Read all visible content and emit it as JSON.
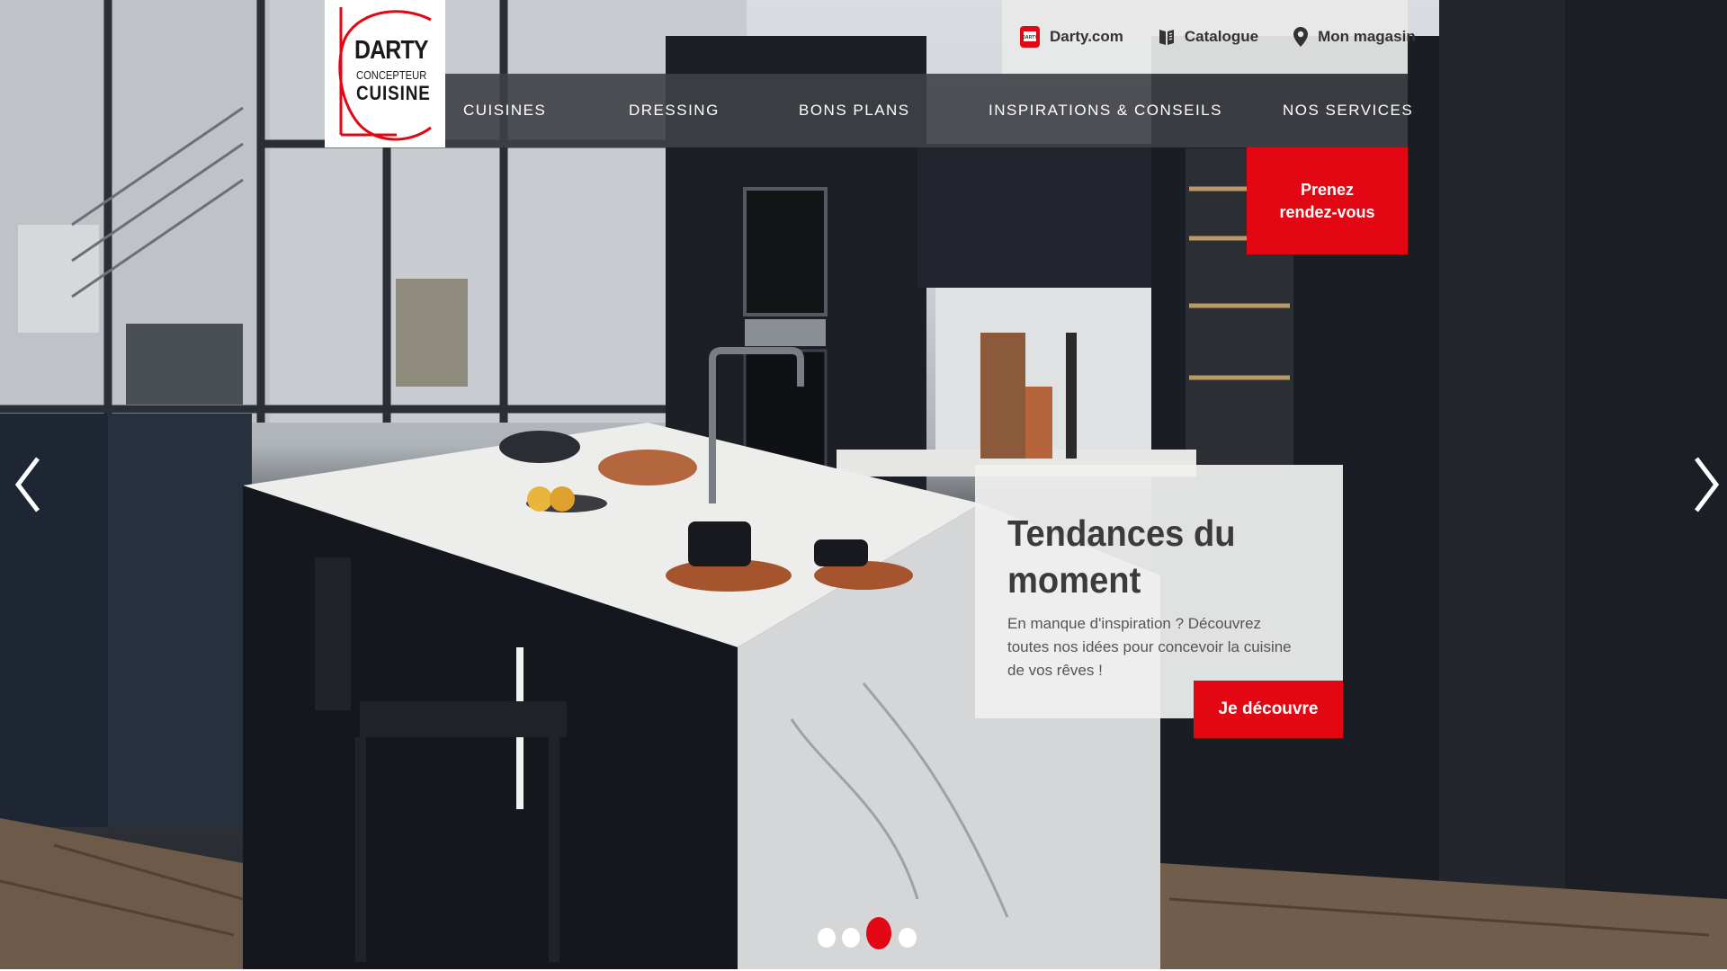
{
  "brand": {
    "logo_line1": "DARTY",
    "logo_line2": "CONCEPTEUR",
    "logo_line3": "CUISINE",
    "accent_color": "#e30613"
  },
  "utility_nav": [
    {
      "label": "Darty.com",
      "icon": "darty-logo-icon"
    },
    {
      "label": "Catalogue",
      "icon": "book-icon"
    },
    {
      "label": "Mon magasin",
      "icon": "location-pin-icon"
    }
  ],
  "main_nav": [
    {
      "label": "CUISINES"
    },
    {
      "label": "DRESSING"
    },
    {
      "label": "BONS PLANS"
    },
    {
      "label": "INSPIRATIONS & CONSEILS"
    },
    {
      "label": "NOS SERVICES"
    }
  ],
  "appointment_button": {
    "line1": "Prenez",
    "line2": "rendez-vous"
  },
  "promo": {
    "title": "Tendances du moment",
    "description": "En manque d'inspiration ? Découvrez toutes nos idées pour concevoir la cuisine de vos rêves !",
    "cta_label": "Je découvre"
  },
  "carousel": {
    "slide_count": 4,
    "active_index": 2,
    "prev_icon": "chevron-left-icon",
    "next_icon": "chevron-right-icon"
  }
}
